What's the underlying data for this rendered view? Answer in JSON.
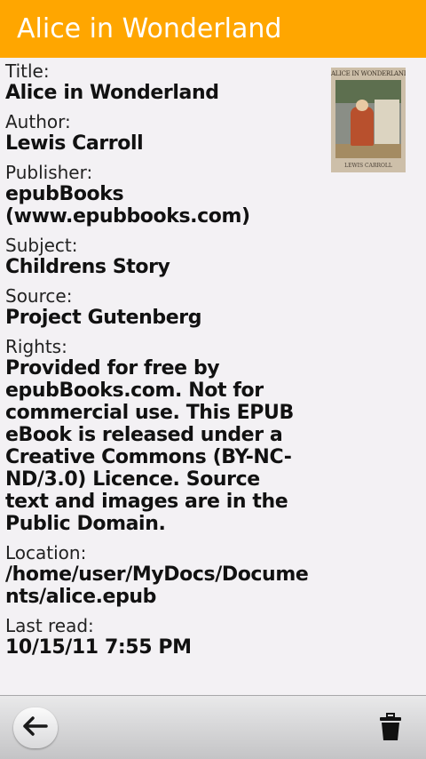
{
  "header": {
    "title": "Alice in Wonderland"
  },
  "fields": [
    {
      "label": "Title:",
      "value": "Alice in Wonderland"
    },
    {
      "label": "Author:",
      "value": "Lewis Carroll"
    },
    {
      "label": "Publisher:",
      "value": "epubBooks (www.epubbooks.com)"
    },
    {
      "label": "Subject:",
      "value": "Childrens Story"
    },
    {
      "label": "Source:",
      "value": "Project Gutenberg"
    },
    {
      "label": "Rights:",
      "value": "Provided for free by epubBooks.com. Not for commercial use. This EPUB eBook is released under a Creative Commons (BY-NC-ND/3.0) Licence. Source text and images are in the Public Domain."
    },
    {
      "label": "Location:",
      "value": "/home/user/MyDocs/Documents/alice.epub"
    },
    {
      "label": "Last read:",
      "value": "10/15/11 7:55 PM"
    }
  ],
  "cover": {
    "title_text": "ALICE IN WONDERLAND",
    "author_text": "LEWIS CARROLL"
  },
  "toolbar": {
    "back_icon": "back-arrow-icon",
    "delete_icon": "trash-icon"
  },
  "colors": {
    "header_bg": "#ffa600",
    "page_bg": "#f3f1f4"
  }
}
